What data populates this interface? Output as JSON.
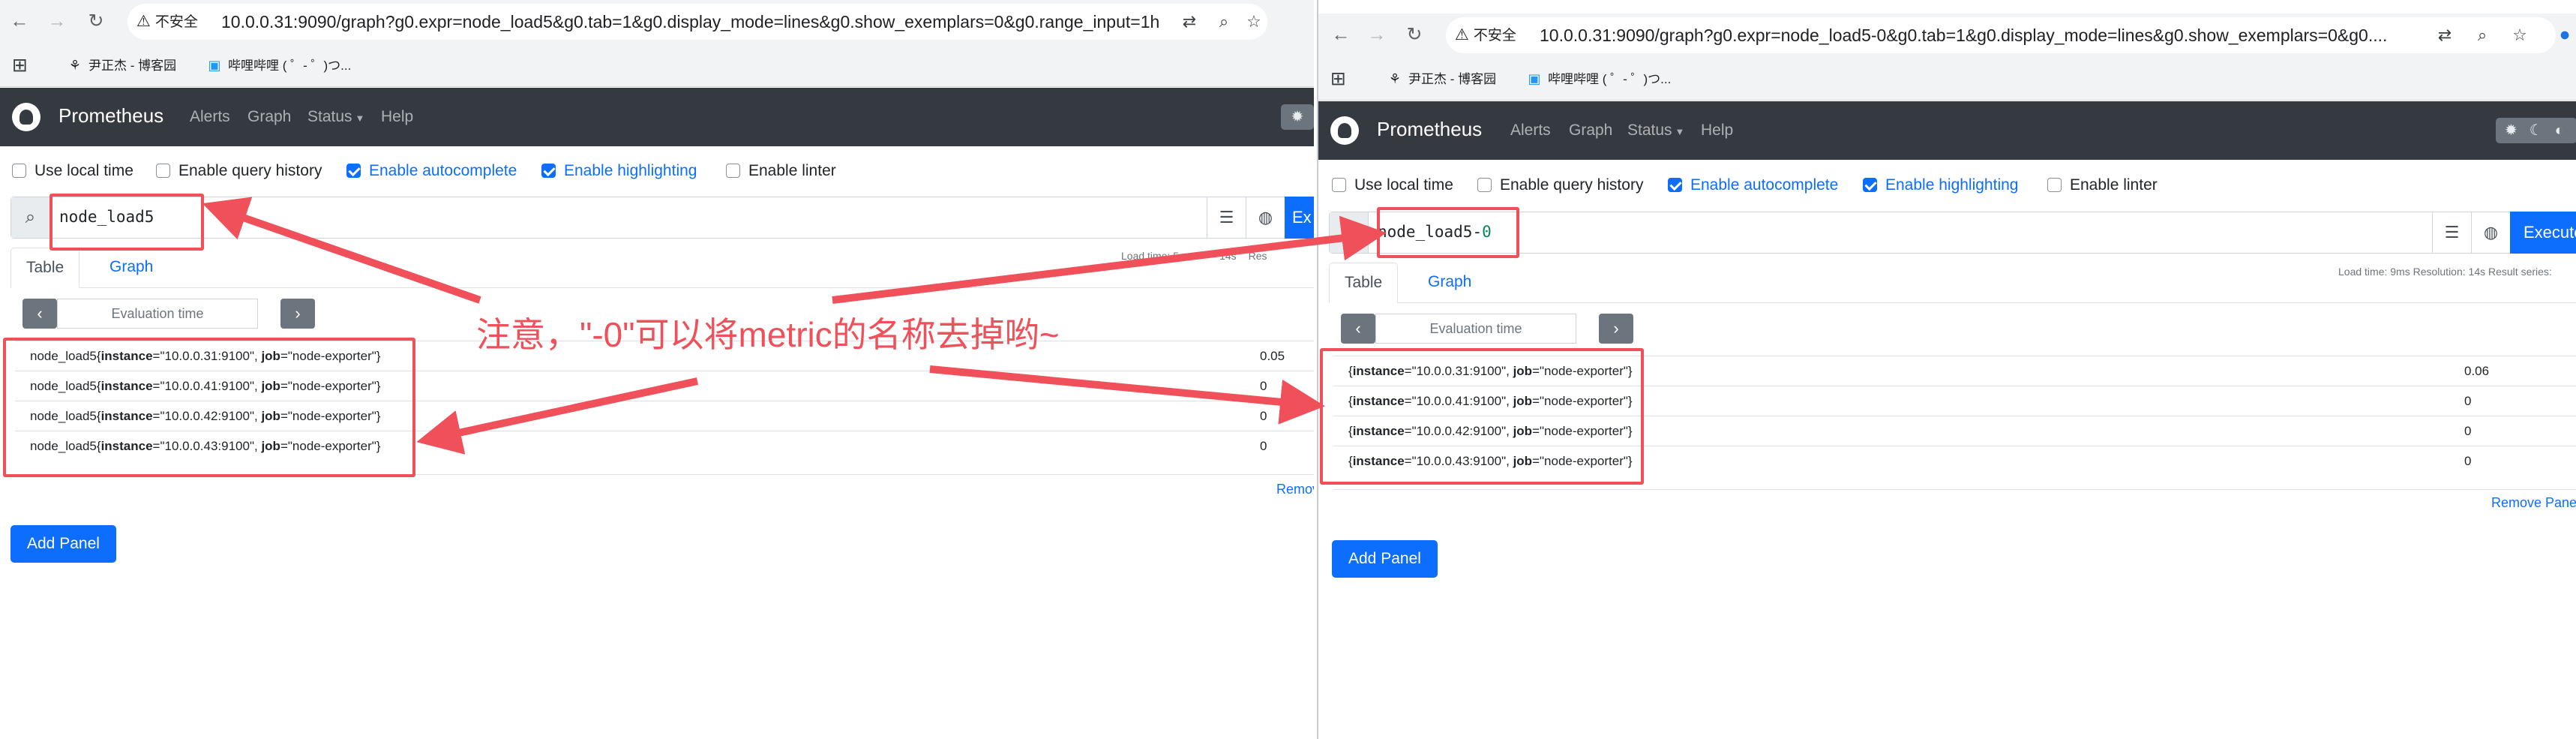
{
  "left": {
    "url": "10.0.0.31:9090/graph?g0.expr=node_load5&g0.tab=1&g0.display_mode=lines&g0.show_exemplars=0&g0.range_input=1h",
    "query": "node_load5",
    "execute_label": "Ex",
    "stats_text": "Load time: 5",
    "stats_text_2": "14s",
    "stats_text_3": "Res",
    "remove_label": "Remov",
    "rows": [
      {
        "metric": "node_load5",
        "instance": "10.0.0.31:9100",
        "job": "node-exporter",
        "value": "0.05"
      },
      {
        "metric": "node_load5",
        "instance": "10.0.0.41:9100",
        "job": "node-exporter",
        "value": "0"
      },
      {
        "metric": "node_load5",
        "instance": "10.0.0.42:9100",
        "job": "node-exporter",
        "value": "0"
      },
      {
        "metric": "node_load5",
        "instance": "10.0.0.43:9100",
        "job": "node-exporter",
        "value": "0"
      }
    ]
  },
  "right": {
    "url": "10.0.0.31:9090/graph?g0.expr=node_load5-0&g0.tab=1&g0.display_mode=lines&g0.show_exemplars=0&g0....",
    "query_name": "node_load5",
    "query_op": "-",
    "query_num": "0",
    "execute_label": "Execute",
    "stats_text": "Load time: 9ms   Resolution: 14s   Result series:",
    "remove_label": "Remove Panel",
    "rows": [
      {
        "metric": "",
        "instance": "10.0.0.31:9100",
        "job": "node-exporter",
        "value": "0.06"
      },
      {
        "metric": "",
        "instance": "10.0.0.41:9100",
        "job": "node-exporter",
        "value": "0"
      },
      {
        "metric": "",
        "instance": "10.0.0.42:9100",
        "job": "node-exporter",
        "value": "0"
      },
      {
        "metric": "",
        "instance": "10.0.0.43:9100",
        "job": "node-exporter",
        "value": "0"
      }
    ]
  },
  "browser": {
    "security_label": "不安全",
    "bookmark_1": "尹正杰 - 博客园",
    "bookmark_2": "哔哩哔哩 ( ゜- ゜)つ..."
  },
  "app": {
    "brand": "Prometheus",
    "nav": [
      "Alerts",
      "Graph",
      "Status",
      "Help"
    ],
    "options": {
      "use_local_time": "Use local time",
      "enable_query_history": "Enable query history",
      "enable_autocomplete": "Enable autocomplete",
      "enable_highlighting": "Enable highlighting",
      "enable_linter": "Enable linter"
    },
    "tab_table": "Table",
    "tab_graph": "Graph",
    "evaluation_time_placeholder": "Evaluation time",
    "add_panel": "Add Panel"
  },
  "annotation": {
    "note": "注意，\"-0\"可以将metric的名称去掉哟~",
    "color": "#f0505a"
  },
  "colors": {
    "navbar": "#343a40",
    "primary": "#0d6efd"
  }
}
